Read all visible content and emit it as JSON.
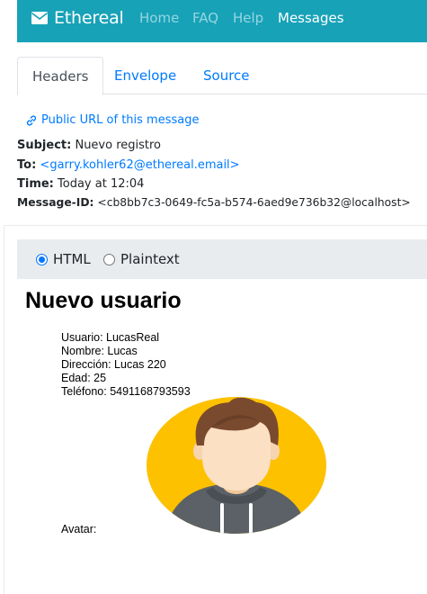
{
  "navbar": {
    "brand": "Ethereal",
    "links": [
      "Home",
      "FAQ",
      "Help",
      "Messages"
    ],
    "active": "Messages"
  },
  "tabs": [
    "Headers",
    "Envelope",
    "Source"
  ],
  "active_tab": "Headers",
  "meta": {
    "public_url_label": "Public URL of this message",
    "subject_label": "Subject:",
    "subject": "Nuevo registro",
    "to_label": "To:",
    "to": "<garry.kohler62@ethereal.email>",
    "time_label": "Time:",
    "time": "Today at 12:04",
    "message_id_label": "Message-ID:",
    "message_id": "<cb8bb7c3-0649-fc5a-b574-6aed9e736b32@localhost>"
  },
  "view_toggle": {
    "options": [
      "HTML",
      "Plaintext"
    ],
    "selected": "HTML"
  },
  "email": {
    "title": "Nuevo usuario",
    "lines": [
      "Usuario: LucasReal",
      "Nombre: Lucas",
      "Dirección: Lucas 220",
      "Edad: 25",
      "Teléfono: 5491168793593"
    ],
    "avatar_label": "Avatar:"
  },
  "colors": {
    "navbar": "#17a2b8",
    "link": "#007bff",
    "avatar_bg": "#fdc100",
    "hair": "#7a4a2e",
    "hoodie": "#5b6166"
  }
}
